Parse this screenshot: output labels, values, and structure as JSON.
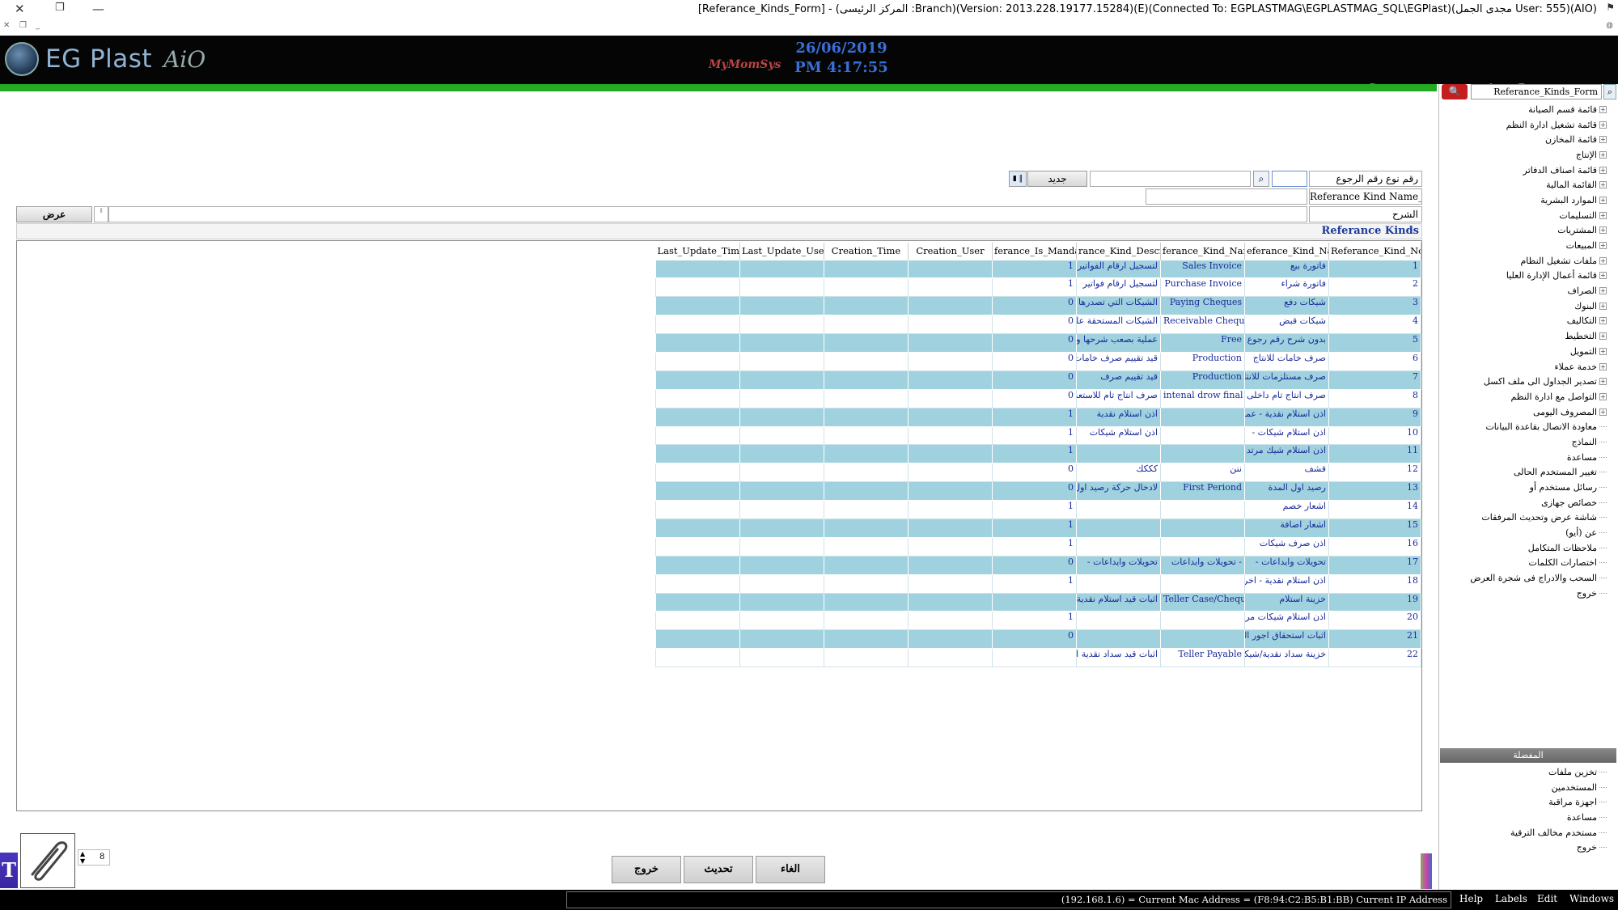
{
  "window": {
    "title": "[Referance_Kinds_Form] - (المركز الرئيسى :Branch)(Version: 2013.228.19177.15284)(E)(Connected To: EGPLASTMAG\\EGPLASTMAG_SQL\\EGPlast)(مجدى الجمل User: 555)(AIO)"
  },
  "header": {
    "logo_text": "EG Plast",
    "logo_suffix": "AiO",
    "brand_small": "MyMomSys",
    "date": "26/06/2019",
    "time": "PM 4:17:55",
    "form_title": "Referance_Kinds_Form"
  },
  "sidebar": {
    "search_value": "Referance_Kinds_Form",
    "items": [
      "قائمة قسم الصيانة",
      "قائمة تشغيل ادارة النظم",
      "قائمة المخازن",
      "الإنتاج",
      "قائمة اصناف الدفاتر",
      "القائمة المالية",
      "الموارد البشرية",
      "التسليمات",
      "المشتريات",
      "المبيعات",
      "ملفات تشغيل النظام",
      "قائمة أعمال الإدارة العليا",
      "الصراف",
      "البنوك",
      "التكاليف",
      "التخطيط",
      "التمويل",
      "خدمة عملاء",
      "تصدير الجداول الى ملف اكسل",
      "التواصل مع ادارة النظم",
      "المصروف اليومى",
      "معاودة الاتصال بقاعدة البيانات",
      "النماذج",
      "مساعدة",
      "تغيير المستخدم الحالى",
      "رسائل مستخدم أو",
      "خصائص جهازى",
      "شاشة عرض وتحديث المرفقات",
      "عن (أيو)",
      "ملاحظات المتكامل",
      "اختصارات الكلمات",
      "السحب والادراج فى شجرة العرض",
      "خروج"
    ],
    "favorites_header": "المفضلة",
    "favorites": [
      "تخزين ملفات",
      "المستخدمين",
      "اجهزة مراقبة",
      "مساعدة",
      "مستخدم مخالف الترقية",
      "خروج"
    ]
  },
  "form": {
    "ref_no_label": "رقم نوع رقم الرجوع",
    "ref_no_value": "",
    "new_button": "جديد",
    "kind_name_f_label": "Referance Kind Name_F",
    "explain_label": "الشرح",
    "show_button": "عرض",
    "grid_title": "Referance Kinds"
  },
  "grid": {
    "columns": [
      "Referance_Kind_No",
      "eferance_Kind_Nam",
      "ferance_Kind_Name",
      "rance_Kind_Descrip",
      "ferance_Is_Mandato",
      "Creation_User",
      "Creation_Time",
      "Last_Update_User",
      "Last_Update_Time"
    ],
    "rows": [
      {
        "no": "1",
        "name_ar": "فاتورة بيع",
        "name_en": "Sales Invoice",
        "desc": "لتسجيل ارقام الفواتير",
        "mand": "1"
      },
      {
        "no": "2",
        "name_ar": "فاتورة شراء",
        "name_en": "Purchase Invoice",
        "desc": "لتسجيل ارقام فواتير",
        "mand": "1"
      },
      {
        "no": "3",
        "name_ar": "شيكات دفع",
        "name_en": "Paying Cheques",
        "desc": "الشيكات التي تصدرها",
        "mand": "0"
      },
      {
        "no": "4",
        "name_ar": "شيكات قبض",
        "name_en": "Receivable Cheques",
        "desc": "الشيكات المستحقة على",
        "mand": "0"
      },
      {
        "no": "5",
        "name_ar": "بدون شرح رقم رجوع",
        "name_en": "Free",
        "desc": "عملية بصعب شرحها ولا",
        "mand": "0"
      },
      {
        "no": "6",
        "name_ar": "صرف خامات للانتاج",
        "name_en": "Production",
        "desc": "قيد تقييم صرف خامات",
        "mand": "0"
      },
      {
        "no": "7",
        "name_ar": "صرف مستلزمات للانتاج",
        "name_en": "Production",
        "desc": "قيد تقييم صرف",
        "mand": "0"
      },
      {
        "no": "8",
        "name_ar": "صرف انتاج تام داخلى",
        "name_en": "intenal drow final",
        "desc": "صرف انتاج تام للاستعمال",
        "mand": "0"
      },
      {
        "no": "9",
        "name_ar": "اذن استلام نقدية - عملاء",
        "name_en": "",
        "desc": "اذن استلام نقدية",
        "mand": "1"
      },
      {
        "no": "10",
        "name_ar": "اذن استلام شيكات -",
        "name_en": "",
        "desc": "اذن استلام شيكات",
        "mand": "1"
      },
      {
        "no": "11",
        "name_ar": "اذن استلام شيك مرتد",
        "name_en": "",
        "desc": "",
        "mand": "1"
      },
      {
        "no": "12",
        "name_ar": "قشف",
        "name_en": "ننن",
        "desc": "كككك",
        "mand": "0"
      },
      {
        "no": "13",
        "name_ar": "رصيد اول المدة",
        "name_en": "First Periond",
        "desc": "لادخال حركة رصيد اول",
        "mand": "0"
      },
      {
        "no": "14",
        "name_ar": "اشعار خصم",
        "name_en": "",
        "desc": "",
        "mand": "1"
      },
      {
        "no": "15",
        "name_ar": "اشعار اضافة",
        "name_en": "",
        "desc": "",
        "mand": "1"
      },
      {
        "no": "16",
        "name_ar": "اذن صرف شيكات",
        "name_en": "",
        "desc": "",
        "mand": "1"
      },
      {
        "no": "17",
        "name_ar": "تحويلات وايداعات -",
        "name_en": "تحويلات وايداعات -",
        "desc": "تحويلات وايداعات -",
        "mand": "0"
      },
      {
        "no": "18",
        "name_ar": "اذن استلام نقدية - اخرى",
        "name_en": "",
        "desc": "",
        "mand": "1"
      },
      {
        "no": "19",
        "name_ar": "خزينة استلام",
        "name_en": "Teller Case/Cheques",
        "desc": "اثبات قيد استلام نقدية او",
        "mand": ""
      },
      {
        "no": "20",
        "name_ar": "اذن استلام شيكات مرتدة",
        "name_en": "",
        "desc": "",
        "mand": "1"
      },
      {
        "no": "21",
        "name_ar": "اثبات استحقاق اجور السادة",
        "name_en": "",
        "desc": "",
        "mand": "0"
      },
      {
        "no": "22",
        "name_ar": "خزينة سداد نقدية/شيكات",
        "name_en": "Teller Payable",
        "desc": "اثبات قيد سداد نقدية او",
        "mand": ""
      }
    ]
  },
  "bottom": {
    "spin_value": "8",
    "cancel_button": "الغاء",
    "update_button": "تحديث",
    "exit_button": "خروج"
  },
  "statusbar": {
    "ip_text": "(192.168.1.6) = Current Mac Address = (F8:94:C2:B5:B1:BB) Current IP Address",
    "menu": [
      "Help",
      "Labels",
      "Edit",
      "Windows"
    ]
  },
  "colors": {
    "header_bg": "#050505",
    "green_bar": "#22aa22",
    "row_highlight": "#9fd2de",
    "date_blue": "#3a6fd8"
  }
}
